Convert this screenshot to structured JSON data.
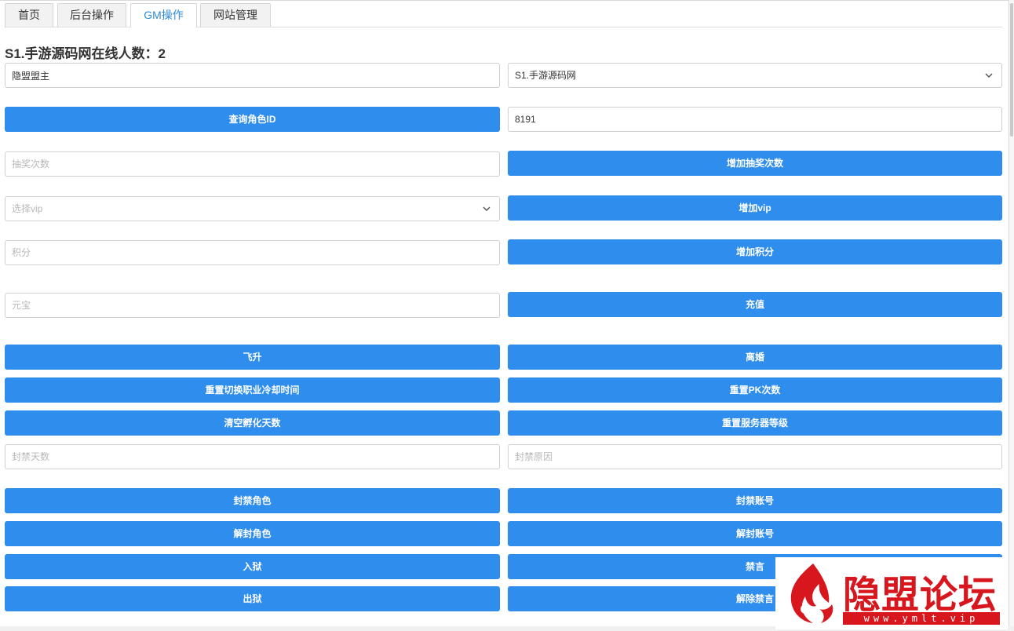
{
  "tabs": [
    {
      "label": "首页"
    },
    {
      "label": "后台操作"
    },
    {
      "label": "GM操作",
      "active": true
    },
    {
      "label": "网站管理"
    }
  ],
  "online": {
    "title": "S1.手游源码网在线人数：2"
  },
  "role_name": {
    "value": "隐盟盟主"
  },
  "server_select": {
    "selected": "S1.手游源码网"
  },
  "query_role_id": {
    "label": "查询角色ID"
  },
  "role_id": {
    "value": "8191"
  },
  "lottery": {
    "placeholder": "抽奖次数",
    "button": "增加抽奖次数"
  },
  "vip": {
    "placeholder": "选择vip",
    "button": "增加vip"
  },
  "points": {
    "placeholder": "积分",
    "button": "增加积分"
  },
  "yuanbao": {
    "placeholder": "元宝",
    "button": "充值"
  },
  "actions": {
    "ascend": "飞升",
    "divorce": "离婚",
    "reset_job_cooldown": "重置切换职业冷却时间",
    "reset_pk": "重置PK次数",
    "clear_hatch_days": "清空孵化天数",
    "reset_server_level": "重置服务器等级"
  },
  "ban": {
    "days_placeholder": "封禁天数",
    "reason_placeholder": "封禁原因",
    "ban_role": "封禁角色",
    "ban_account": "封禁账号",
    "unban_role": "解封角色",
    "unban_account": "解封账号",
    "jail": "入狱",
    "mute": "禁言",
    "release": "出狱",
    "unmute": "解除禁言"
  },
  "watermark": {
    "text": "隐盟论坛",
    "url": "www.ymlt.vip",
    "logo": "flame-logo-icon"
  },
  "colors": {
    "accent": "#2e8ded",
    "active_tab": "#2f8bd8",
    "watermark": "#d8161d"
  }
}
